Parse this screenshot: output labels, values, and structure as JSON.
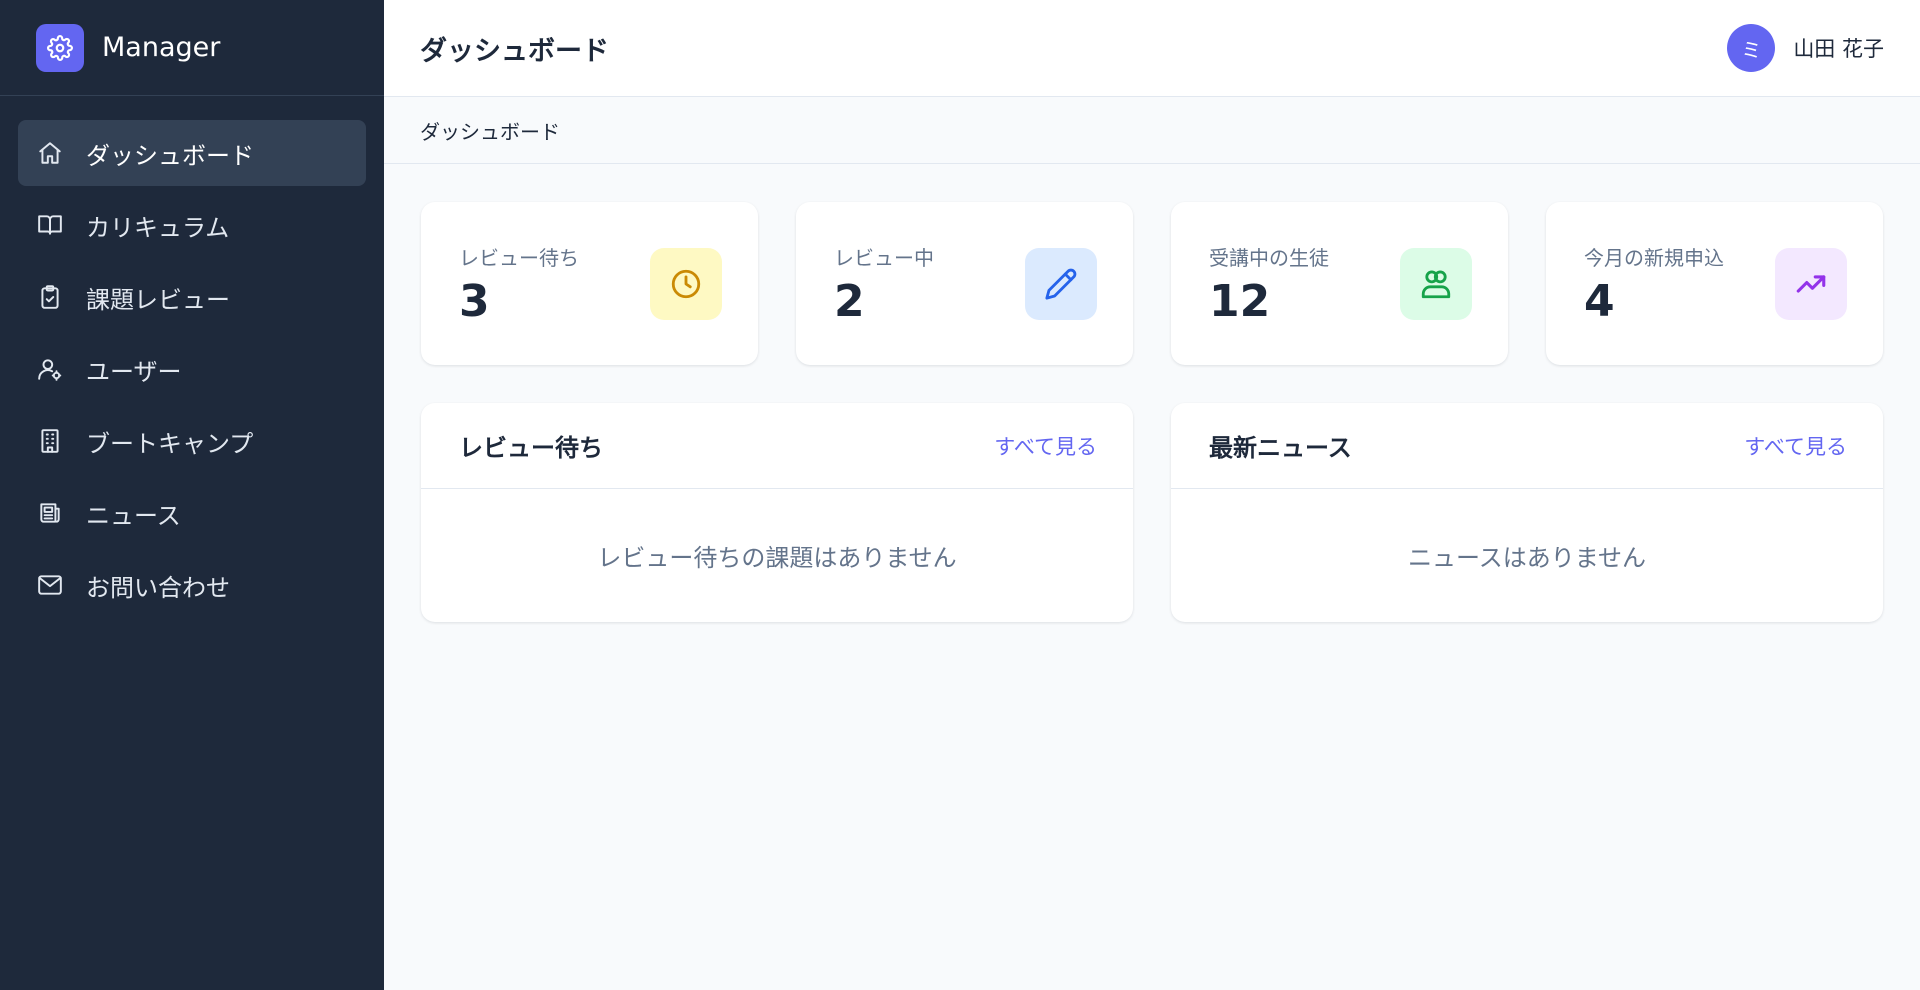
{
  "brand": {
    "name": "Manager",
    "icon": "gear-icon",
    "color": "#6366f1"
  },
  "sidebar": {
    "items": [
      {
        "label": "ダッシュボード",
        "icon": "home-icon",
        "active": true
      },
      {
        "label": "カリキュラム",
        "icon": "book-icon"
      },
      {
        "label": "課題レビュー",
        "icon": "clipboard-check-icon"
      },
      {
        "label": "ユーザー",
        "icon": "user-cog-icon"
      },
      {
        "label": "ブートキャンプ",
        "icon": "building-icon"
      },
      {
        "label": "ニュース",
        "icon": "newspaper-icon"
      },
      {
        "label": "お問い合わせ",
        "icon": "mail-icon"
      }
    ]
  },
  "header": {
    "title": "ダッシュボード",
    "user": {
      "avatar_initial": "ミ",
      "name": "山田 花子"
    }
  },
  "breadcrumb": "ダッシュボード",
  "stats": [
    {
      "label": "レビュー待ち",
      "value": "3",
      "icon": "clock-icon",
      "icon_color": "#ca8a04",
      "icon_bg": "#fef9c3"
    },
    {
      "label": "レビュー中",
      "value": "2",
      "icon": "pencil-icon",
      "icon_color": "#2563eb",
      "icon_bg": "#dbeafe"
    },
    {
      "label": "受講中の生徒",
      "value": "12",
      "icon": "users-icon",
      "icon_color": "#16a34a",
      "icon_bg": "#dcfce7"
    },
    {
      "label": "今月の新規申込",
      "value": "4",
      "icon": "trending-up-icon",
      "icon_color": "#9333ea",
      "icon_bg": "#f3e8ff"
    }
  ],
  "panels": {
    "reviews": {
      "title": "レビュー待ち",
      "link": "すべて見る",
      "empty": "レビュー待ちの課題はありません"
    },
    "news": {
      "title": "最新ニュース",
      "link": "すべて見る",
      "empty": "ニュースはありません"
    }
  }
}
